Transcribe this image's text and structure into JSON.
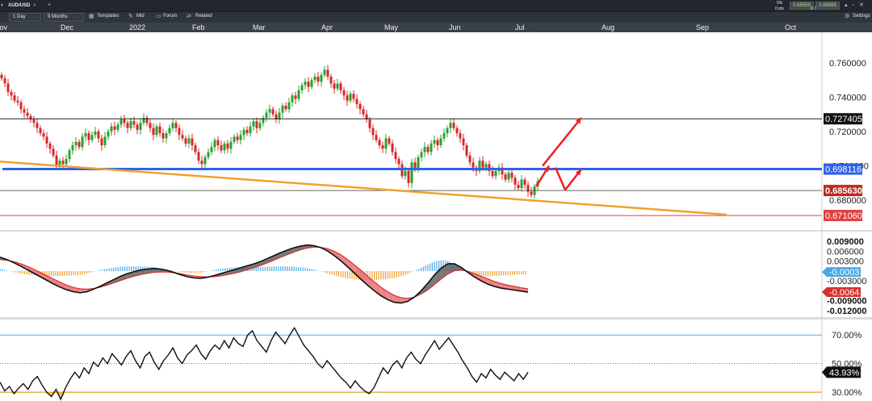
{
  "window": {
    "symbol": "AUD/USD",
    "quote_change": "0%",
    "quote_pts": "0 pts",
    "bid": "0.68559",
    "ask": "0.68566",
    "spread": "0.7",
    "settings_label": "Settings"
  },
  "toolbar": {
    "interval": "1 Day",
    "range": "9 Months",
    "templates": "Templates",
    "mid": "Mid",
    "forum": "Forum",
    "related": "Related"
  },
  "timeline": {
    "labels": [
      "Nov",
      "Dec",
      "2022",
      "Feb",
      "Mar",
      "Apr",
      "May",
      "Jun",
      "Jul",
      "Aug",
      "Sep",
      "Oct"
    ]
  },
  "colors": {
    "up_candle": "#2ca02c",
    "down_candle": "#d62728",
    "support_line": "#2f62e8",
    "trend_line": "#f0a030",
    "macd_signal_fill": "#e87070",
    "hist_positive": "#4aa8e8",
    "hist_negative": "#f0a030",
    "arrow": "#f02020"
  },
  "icons": [
    "search-icon",
    "plus-icon",
    "grid-icon",
    "pencil-icon",
    "chat-icon",
    "link-icon",
    "gear-icon",
    "window-controls-icon",
    "triangle-marker-icon"
  ],
  "chart_data": [
    {
      "type": "candlestick",
      "name": "price",
      "ylim": [
        0.665,
        0.775
      ],
      "yticks": [
        "0.760000",
        "0.740000",
        "0.720000",
        "0.680000"
      ],
      "price_labels": {
        "resistance": "0.727405",
        "support": "0.698116",
        "current": "0.685630",
        "low_line": "0.671060",
        "hidden": "0.700000"
      },
      "horizontal_lines": [
        0.727405,
        0.698116,
        0.68563,
        0.67106
      ],
      "trendline": {
        "from": [
          0,
          0.7025
        ],
        "to": [
          225,
          0.6716
        ]
      },
      "closes": [
        0.751,
        0.748,
        0.743,
        0.741,
        0.738,
        0.737,
        0.733,
        0.731,
        0.729,
        0.727,
        0.725,
        0.722,
        0.719,
        0.717,
        0.713,
        0.71,
        0.706,
        0.7,
        0.703,
        0.701,
        0.704,
        0.709,
        0.712,
        0.714,
        0.711,
        0.717,
        0.719,
        0.715,
        0.718,
        0.72,
        0.716,
        0.712,
        0.717,
        0.72,
        0.723,
        0.721,
        0.724,
        0.727,
        0.725,
        0.722,
        0.726,
        0.724,
        0.721,
        0.725,
        0.728,
        0.725,
        0.722,
        0.718,
        0.723,
        0.719,
        0.716,
        0.719,
        0.722,
        0.725,
        0.722,
        0.718,
        0.716,
        0.713,
        0.716,
        0.712,
        0.708,
        0.703,
        0.701,
        0.705,
        0.708,
        0.711,
        0.715,
        0.712,
        0.709,
        0.713,
        0.71,
        0.714,
        0.717,
        0.715,
        0.718,
        0.721,
        0.719,
        0.723,
        0.726,
        0.722,
        0.725,
        0.728,
        0.731,
        0.733,
        0.73,
        0.727,
        0.731,
        0.735,
        0.733,
        0.737,
        0.741,
        0.739,
        0.744,
        0.747,
        0.749,
        0.746,
        0.75,
        0.752,
        0.749,
        0.753,
        0.756,
        0.752,
        0.748,
        0.745,
        0.748,
        0.744,
        0.741,
        0.738,
        0.742,
        0.739,
        0.736,
        0.733,
        0.73,
        0.727,
        0.722,
        0.718,
        0.715,
        0.712,
        0.71,
        0.716,
        0.713,
        0.708,
        0.704,
        0.701,
        0.694,
        0.697,
        0.69,
        0.702,
        0.698,
        0.705,
        0.708,
        0.711,
        0.708,
        0.713,
        0.715,
        0.712,
        0.716,
        0.719,
        0.722,
        0.725,
        0.722,
        0.719,
        0.716,
        0.712,
        0.706,
        0.702,
        0.699,
        0.697,
        0.703,
        0.699,
        0.701,
        0.697,
        0.694,
        0.697,
        0.699,
        0.695,
        0.692,
        0.696,
        0.693,
        0.689,
        0.687,
        0.692,
        0.689,
        0.685,
        0.683,
        0.688,
        0.691
      ],
      "arrows": [
        {
          "from": [
            168,
            0.7
          ],
          "to": [
            180,
            0.728
          ]
        },
        {
          "from": [
            166,
            0.688
          ],
          "to": [
            170,
            0.7
          ]
        },
        {
          "from": [
            172,
            0.699
          ],
          "to": [
            175,
            0.686
          ]
        },
        {
          "from": [
            175,
            0.686
          ],
          "to": [
            180,
            0.698
          ]
        }
      ]
    },
    {
      "type": "line",
      "name": "macd",
      "ylim": [
        -0.013,
        0.0115
      ],
      "yticks": [
        "0.009000",
        "0.006000",
        "0.003000",
        "-0.003000",
        "-0.009000",
        "-0.012000"
      ],
      "value_labels": {
        "histogram": "-0.0003",
        "macd": "-0.0064"
      },
      "macd": [
        0.0042,
        0.0035,
        0.0026,
        0.0016,
        0.0005,
        -0.0006,
        -0.0017,
        -0.0028,
        -0.0039,
        -0.0049,
        -0.0057,
        -0.0063,
        -0.0066,
        -0.0063,
        -0.0055,
        -0.0046,
        -0.0036,
        -0.0026,
        -0.0016,
        -0.0008,
        -0.0002,
        0.0003,
        0.0006,
        0.0008,
        0.0006,
        0.0002,
        -0.0004,
        -0.0011,
        -0.0017,
        -0.0021,
        -0.0022,
        -0.0019,
        -0.0014,
        -0.0008,
        -0.0002,
        0.0004,
        0.001,
        0.0016,
        0.0022,
        0.0029,
        0.0038,
        0.0047,
        0.0056,
        0.0064,
        0.0071,
        0.0076,
        0.0079,
        0.0077,
        0.0071,
        0.0061,
        0.0047,
        0.0031,
        0.0013,
        -0.0006,
        -0.0025,
        -0.0043,
        -0.006,
        -0.0075,
        -0.0087,
        -0.0095,
        -0.0097,
        -0.0092,
        -0.0079,
        -0.006,
        -0.0037,
        -0.0012,
        0.0009,
        0.0022,
        0.0022,
        0.0011,
        -0.0004,
        -0.0018,
        -0.003,
        -0.004,
        -0.0047,
        -0.0052,
        -0.0055,
        -0.0058,
        -0.0061,
        -0.0064
      ],
      "signal": [
        0.0035,
        0.0033,
        0.0029,
        0.0023,
        0.0015,
        0.0006,
        -0.0004,
        -0.0014,
        -0.0024,
        -0.0034,
        -0.0043,
        -0.005,
        -0.0054,
        -0.0055,
        -0.0053,
        -0.0049,
        -0.0043,
        -0.0036,
        -0.0029,
        -0.0022,
        -0.0016,
        -0.0011,
        -0.0007,
        -0.0004,
        -0.0003,
        -0.0003,
        -0.0005,
        -0.0008,
        -0.0012,
        -0.0015,
        -0.0017,
        -0.0018,
        -0.0017,
        -0.0015,
        -0.0011,
        -0.0007,
        -0.0002,
        0.0004,
        0.001,
        0.0017,
        0.0025,
        0.0033,
        0.0042,
        0.005,
        0.0058,
        0.0065,
        0.007,
        0.0073,
        0.0072,
        0.0068,
        0.006,
        0.0049,
        0.0035,
        0.0019,
        0.0002,
        -0.0016,
        -0.0033,
        -0.0049,
        -0.0063,
        -0.0074,
        -0.0081,
        -0.0083,
        -0.0079,
        -0.007,
        -0.0057,
        -0.0041,
        -0.0024,
        -0.0009,
        0.0001,
        0.0003,
        -0.0001,
        -0.0008,
        -0.0016,
        -0.0024,
        -0.0032,
        -0.0038,
        -0.0043,
        -0.0047,
        -0.0051,
        -0.0054
      ],
      "histogram": [
        0.0007,
        0.0002,
        -0.0003,
        -0.0007,
        -0.001,
        -0.0012,
        -0.0013,
        -0.0014,
        -0.0015,
        -0.0015,
        -0.0014,
        -0.0013,
        -0.0012,
        -0.0008,
        -0.0002,
        0.0003,
        0.0007,
        0.001,
        0.0013,
        0.0014,
        0.0014,
        0.0014,
        0.0013,
        0.0012,
        0.0009,
        0.0005,
        0.0001,
        -0.0003,
        -0.0005,
        -0.0006,
        -0.0005,
        -0.0001,
        0.0003,
        0.0007,
        0.0009,
        0.0011,
        0.0012,
        0.0012,
        0.0012,
        0.0012,
        0.0013,
        0.0014,
        0.0014,
        0.0014,
        0.0013,
        0.0011,
        0.0009,
        0.0004,
        -0.0001,
        -0.0007,
        -0.0013,
        -0.0018,
        -0.0022,
        -0.0025,
        -0.0027,
        -0.0027,
        -0.0027,
        -0.0026,
        -0.0024,
        -0.0021,
        -0.0016,
        -0.0009,
        0.0,
        0.001,
        0.002,
        0.0029,
        0.0033,
        0.0031,
        0.0021,
        0.0008,
        -0.0003,
        -0.001,
        -0.0014,
        -0.0016,
        -0.0015,
        -0.0014,
        -0.0012,
        -0.0011,
        -0.001,
        -0.001
      ]
    },
    {
      "type": "line",
      "name": "rsi",
      "ylim": [
        25,
        78
      ],
      "yticks": [
        "70.00%",
        "50.00%",
        "30.00%"
      ],
      "levels": [
        70,
        50,
        30
      ],
      "value_label": "43.93%",
      "values": [
        37,
        31,
        34,
        29,
        33,
        36,
        32,
        38,
        41,
        35,
        30,
        27,
        32,
        25,
        33,
        39,
        44,
        40,
        47,
        43,
        51,
        48,
        54,
        50,
        57,
        53,
        49,
        55,
        59,
        52,
        47,
        55,
        58,
        51,
        46,
        52,
        56,
        61,
        54,
        50,
        56,
        59,
        63,
        57,
        53,
        59,
        63,
        60,
        66,
        61,
        68,
        64,
        62,
        70,
        73,
        66,
        62,
        58,
        66,
        72,
        68,
        64,
        70,
        75,
        69,
        63,
        59,
        55,
        50,
        47,
        52,
        48,
        44,
        40,
        37,
        33,
        38,
        34,
        31,
        29,
        33,
        40,
        47,
        43,
        49,
        52,
        47,
        54,
        58,
        53,
        50,
        56,
        61,
        66,
        60,
        64,
        68,
        63,
        58,
        52,
        47,
        41,
        37,
        43,
        40,
        46,
        42,
        39,
        44,
        41,
        38,
        43,
        39,
        44
      ]
    }
  ]
}
